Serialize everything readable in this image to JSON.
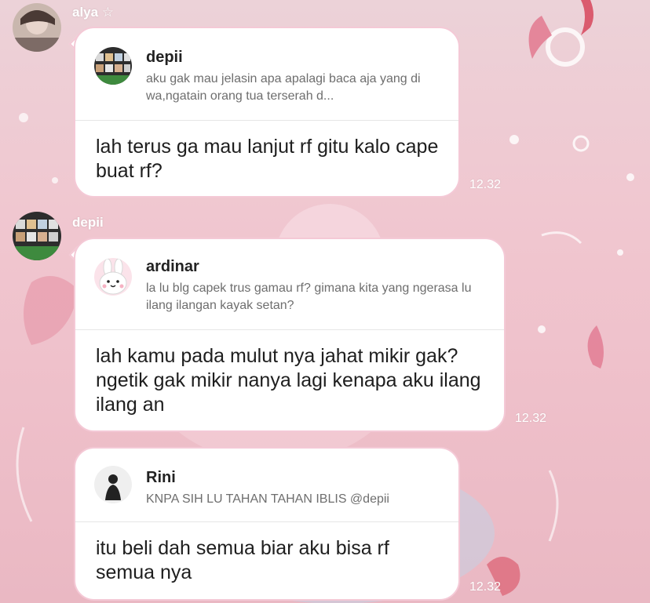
{
  "messages": [
    {
      "sender": "alya ☆",
      "reply": {
        "name": "depii",
        "text": "aku gak mau jelasin apa apalagi baca aja yang di wa,ngatain orang tua terserah d..."
      },
      "text": "lah terus ga mau lanjut rf gitu kalo cape buat rf?",
      "time": "12.32"
    },
    {
      "sender": "depii",
      "reply": {
        "name": "ardinar",
        "text": "la lu blg capek trus gamau rf? gimana kita yang ngerasa lu ilang ilangan kayak setan?"
      },
      "text": "lah kamu pada mulut nya jahat mikir gak?ngetik gak mikir nanya lagi kenapa aku ilang ilang an",
      "time": "12.32"
    },
    {
      "reply": {
        "name": "Rini",
        "text": "KNPA SIH LU TAHAN TAHAN IBLIS @depii"
      },
      "text": "itu beli dah semua biar aku bisa rf semua nya",
      "time": "12.32"
    }
  ]
}
